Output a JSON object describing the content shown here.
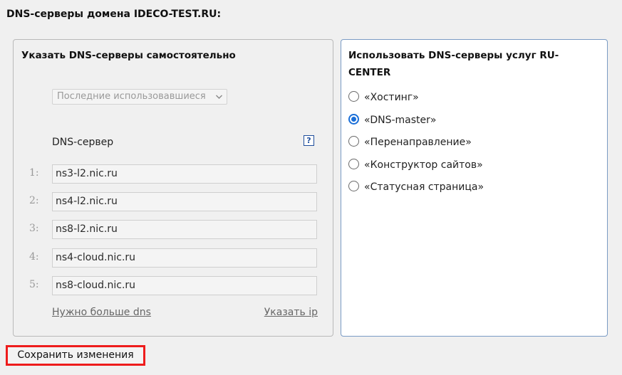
{
  "page": {
    "title": "DNS-серверы домена IDECO-TEST.RU:"
  },
  "manual_panel": {
    "title": "Указать DNS-серверы самостоятельно",
    "select_value": "Последние использовавшиеся",
    "column_label": "DNS-сервер",
    "help_glyph": "?",
    "rows": [
      {
        "num": "1:",
        "value": "ns3-l2.nic.ru"
      },
      {
        "num": "2:",
        "value": "ns4-l2.nic.ru"
      },
      {
        "num": "3:",
        "value": "ns8-l2.nic.ru"
      },
      {
        "num": "4:",
        "value": "ns4-cloud.nic.ru"
      },
      {
        "num": "5:",
        "value": "ns8-cloud.nic.ru"
      }
    ],
    "more_dns_link": "Нужно больше dns",
    "specify_ip_link": "Указать ip"
  },
  "service_panel": {
    "title": "Использовать DNS-серверы услуг RU-CENTER",
    "options": [
      {
        "label": "«Хостинг»",
        "checked": false
      },
      {
        "label": "«DNS-master»",
        "checked": true
      },
      {
        "label": "«Перенаправление»",
        "checked": false
      },
      {
        "label": "«Конструктор сайтов»",
        "checked": false
      },
      {
        "label": "«Статусная страница»",
        "checked": false
      }
    ]
  },
  "actions": {
    "save_label": "Сохранить изменения"
  },
  "colors": {
    "accent_radio": "#1a6fd8",
    "highlight_border": "#ee1c1c",
    "active_panel_border": "#7a9bc4"
  }
}
